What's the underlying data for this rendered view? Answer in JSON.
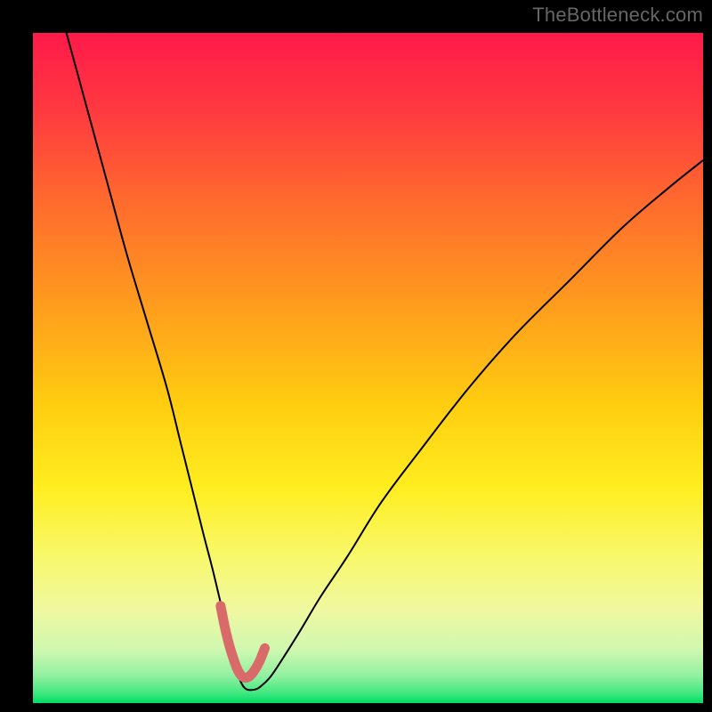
{
  "watermark": "TheBottleneck.com",
  "chart_data": {
    "type": "line",
    "title": "",
    "xlabel": "",
    "ylabel": "",
    "xlim": [
      0,
      100
    ],
    "ylim": [
      0,
      100
    ],
    "grid": false,
    "legend": false,
    "background": {
      "type": "vertical-gradient",
      "stops": [
        {
          "offset": 0.0,
          "color": "#ff1a4a"
        },
        {
          "offset": 0.12,
          "color": "#ff3a3f"
        },
        {
          "offset": 0.25,
          "color": "#ff6a2e"
        },
        {
          "offset": 0.4,
          "color": "#ff9a1e"
        },
        {
          "offset": 0.55,
          "color": "#ffcc10"
        },
        {
          "offset": 0.68,
          "color": "#ffee20"
        },
        {
          "offset": 0.78,
          "color": "#f8f86a"
        },
        {
          "offset": 0.86,
          "color": "#f0f8a0"
        },
        {
          "offset": 0.92,
          "color": "#d0f8b0"
        },
        {
          "offset": 0.96,
          "color": "#90f0a0"
        },
        {
          "offset": 0.985,
          "color": "#40e880"
        },
        {
          "offset": 1.0,
          "color": "#00dd66"
        }
      ]
    },
    "series": [
      {
        "name": "bottleneck-curve",
        "color": "#000000",
        "width": 2,
        "x": [
          5,
          8,
          11,
          14,
          17,
          20,
          22,
          24,
          25.5,
          26.8,
          28,
          29,
          29.8,
          30.4,
          31,
          31.8,
          33,
          34,
          35.5,
          37.5,
          40,
          43,
          47,
          52,
          58,
          65,
          72,
          80,
          88,
          95,
          100
        ],
        "y": [
          100,
          89,
          78,
          67,
          57,
          47,
          39,
          31,
          25,
          20,
          15,
          11,
          7.5,
          5,
          3.2,
          2.1,
          2.0,
          2.5,
          4,
          7,
          11,
          16,
          22,
          30,
          38,
          47,
          55,
          63,
          71,
          77,
          81
        ]
      },
      {
        "name": "optimal-highlight",
        "color": "#d96a6a",
        "width": 11,
        "linecap": "round",
        "x": [
          28.0,
          28.6,
          29.2,
          29.8,
          30.4,
          31.0,
          31.6,
          32.3,
          33.0,
          33.8,
          34.6
        ],
        "y": [
          14.5,
          11.5,
          9.0,
          7.0,
          5.3,
          4.2,
          3.8,
          4.0,
          4.8,
          6.2,
          8.2
        ]
      }
    ]
  }
}
